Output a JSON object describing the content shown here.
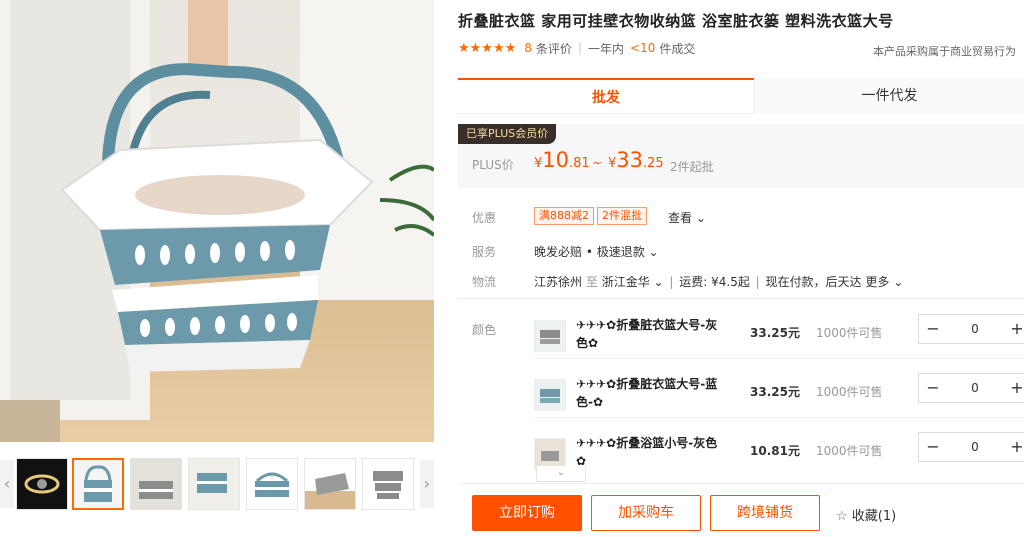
{
  "product": {
    "title": "折叠脏衣篮 家用可挂壁衣物收纳篮 浴室脏衣篓 塑料洗衣篮大号",
    "rating": {
      "stars": "★★★★★",
      "review_count": "8",
      "review_suffix": "条评价",
      "period": "一年内",
      "sold": "<10",
      "sold_suffix": "件成交"
    },
    "trade_note": "本产品采购属于商业贸易行为"
  },
  "tabs": [
    {
      "label": "批发"
    },
    {
      "label": "一件代发"
    }
  ],
  "price": {
    "badge": "已享PLUS会员价",
    "label": "PLUS价",
    "currency": "¥",
    "low_int": "10",
    "low_dec": ".81",
    "tilde": "~",
    "high_int": "33",
    "high_dec": ".25",
    "moq": "2件起批"
  },
  "info": {
    "discount_label": "优惠",
    "coupons": [
      "满888减2",
      "2件混批"
    ],
    "view_label": "查看 ⌄",
    "service_label": "服务",
    "service_value": "晚发必赔 • 极速退款 ⌄",
    "logistics_label": "物流",
    "logistics_from": "江苏徐州",
    "logistics_to_word": "至",
    "logistics_to": "浙江金华 ⌄",
    "freight": "运费: ¥4.5起",
    "delivery": "现在付款，后天达",
    "more": "更多 ⌄"
  },
  "sku": {
    "label": "颜色",
    "items": [
      {
        "name": "✈✈✈✿折叠脏衣篮大号-灰色✿",
        "price": "33.25元",
        "stock": "1000件可售",
        "qty": "0"
      },
      {
        "name": "✈✈✈✿折叠脏衣篮大号-蓝色-✿",
        "price": "33.25元",
        "stock": "1000件可售",
        "qty": "0"
      },
      {
        "name": "✈✈✈✿折叠浴篮小号-灰色✿",
        "price": "10.81元",
        "stock": "1000件可售",
        "qty": "0"
      }
    ],
    "minus": "−",
    "plus": "+",
    "expand": "⌄"
  },
  "actions": {
    "buy_now": "立即订购",
    "add_cart": "加采购车",
    "cross_border": "跨境铺货",
    "collect": "收藏(1)"
  },
  "gallery": {
    "prev": "‹",
    "next": "›",
    "thumbnail_count": 7
  },
  "colors": {
    "accent": "#ff5000",
    "basket_blue": "#6c9aab",
    "plus_dark": "#3a2e2a"
  }
}
